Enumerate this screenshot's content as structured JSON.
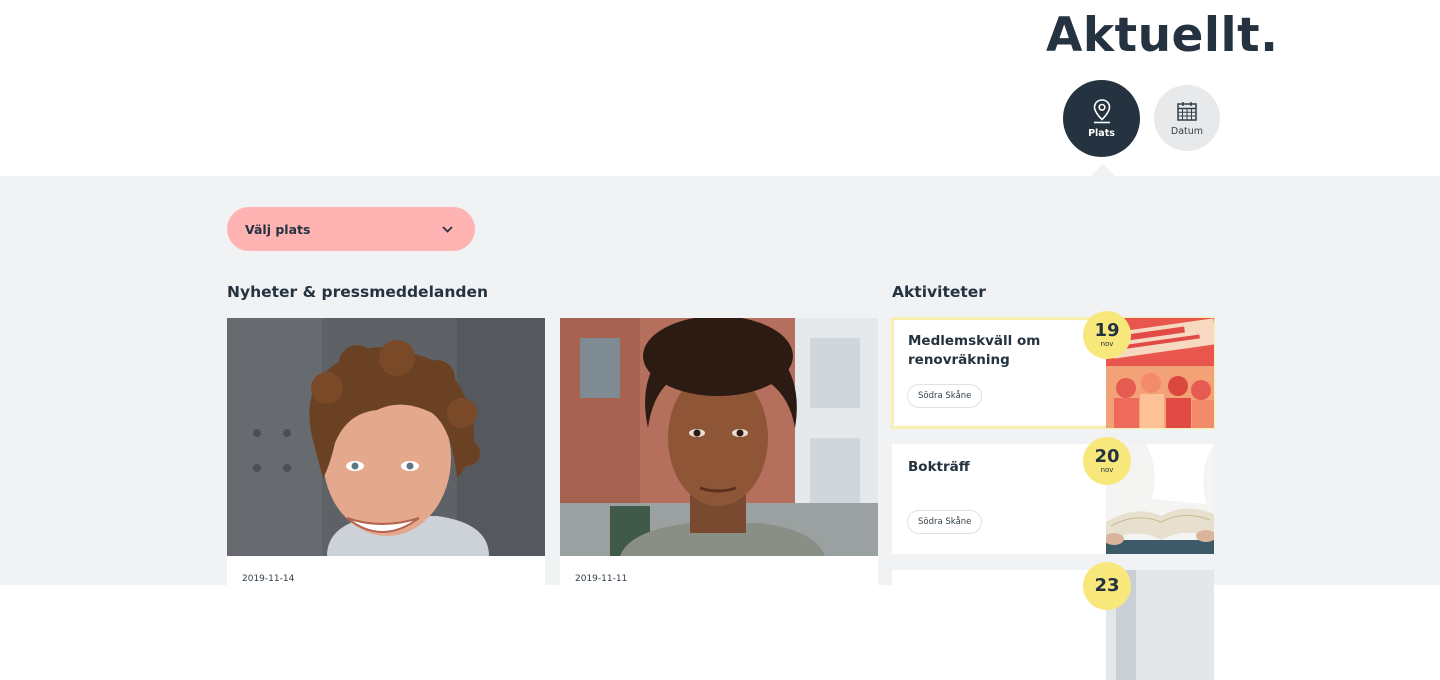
{
  "header": {
    "title": "Aktuellt."
  },
  "filters": [
    {
      "label": "Plats",
      "icon": "map-pin-icon",
      "active": true
    },
    {
      "label": "Datum",
      "icon": "calendar-icon",
      "active": false
    }
  ],
  "location_select": {
    "value": "Välj plats",
    "icon": "chevron-down-icon"
  },
  "news": {
    "heading": "Nyheter & pressmeddelanden",
    "items": [
      {
        "date": "2019-11-14"
      },
      {
        "date": "2019-11-11"
      }
    ]
  },
  "activities": {
    "heading": "Aktiviteter",
    "items": [
      {
        "title": "Medlemskväll om renovräkning",
        "tag": "Södra Skåne",
        "day": "19",
        "month": "nov"
      },
      {
        "title": "Bokträff",
        "tag": "Södra Skåne",
        "day": "20",
        "month": "nov"
      },
      {
        "title": "",
        "tag": "",
        "day": "23",
        "month": ""
      }
    ]
  },
  "colors": {
    "primary": "#24333f",
    "select_bg": "#ffb3b3",
    "date_badge": "#f8e87c",
    "section_bg": "#f1f2f4"
  }
}
